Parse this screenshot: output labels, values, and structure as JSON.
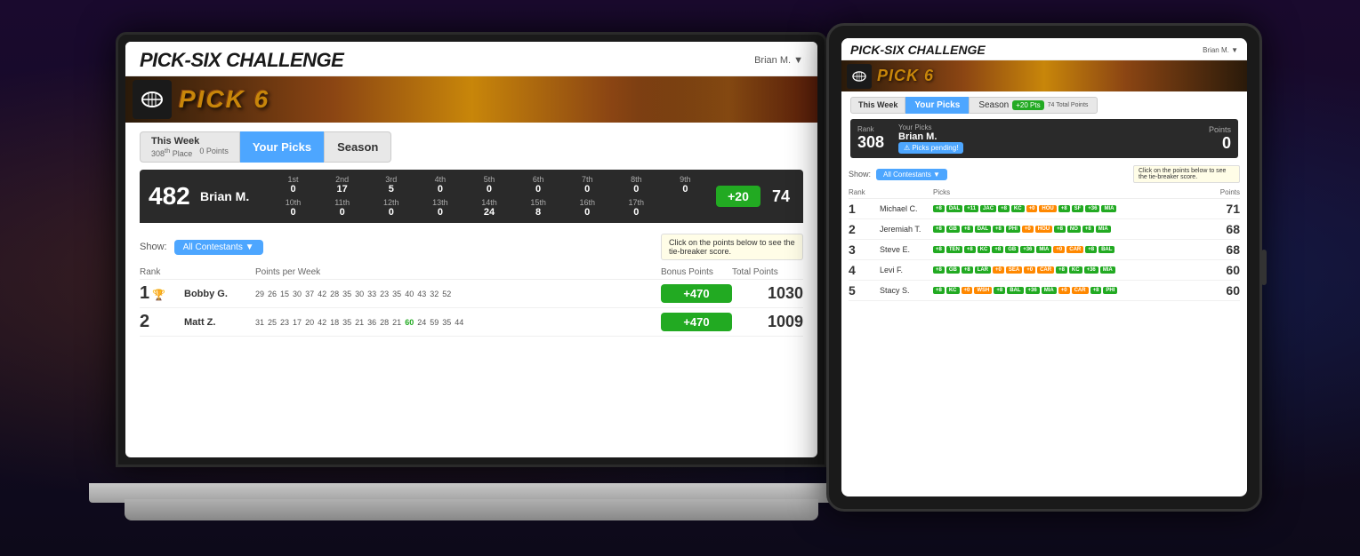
{
  "app": {
    "title": "PICK-SIX CHALLENGE",
    "user": "Brian M. ▼",
    "banner_text": "PICK 6"
  },
  "laptop": {
    "tabs": {
      "this_week": "This Week",
      "your_picks": "Your Picks",
      "season": "Season"
    },
    "current_user": {
      "rank": "482",
      "place": "th",
      "name": "Brian M.",
      "points_week": [
        {
          "label": "1st",
          "val": "0"
        },
        {
          "label": "2nd",
          "val": "17"
        },
        {
          "label": "3rd",
          "val": "5"
        },
        {
          "label": "4th",
          "val": "0"
        },
        {
          "label": "5th",
          "val": "0"
        },
        {
          "label": "6th",
          "val": "0"
        },
        {
          "label": "7th",
          "val": "0"
        },
        {
          "label": "8th",
          "val": "0"
        },
        {
          "label": "9th",
          "val": "0"
        },
        {
          "label": "10th",
          "val": "0"
        },
        {
          "label": "11th",
          "val": "0"
        },
        {
          "label": "12th",
          "val": "0"
        },
        {
          "label": "13th",
          "val": "0"
        },
        {
          "label": "14th",
          "val": "24"
        },
        {
          "label": "15th",
          "val": "8"
        },
        {
          "label": "16th",
          "val": "0"
        },
        {
          "label": "17th",
          "val": "0"
        }
      ],
      "bonus_points": "+20",
      "total_points": "74"
    },
    "show_label": "Show:",
    "show_option": "All Contestants ▼",
    "tooltip": "Click on the points below to see the tie-breaker score.",
    "columns": {
      "rank": "Rank",
      "points_per_week": "Points per Week",
      "bonus_points": "Bonus Points",
      "total_points": "Total Points"
    },
    "leaderboard": [
      {
        "rank": "1",
        "icon": "🏆",
        "name": "Bobby G.",
        "points": "29 26 15 30 37 42 28 35 30 33 23 35 40 43 32 52",
        "bonus": "+470",
        "total": "1030"
      },
      {
        "rank": "2",
        "name": "Matt Z.",
        "points": "31 25 23 17 20 42 18 35 21 36 28 21 60 24 59 35 44",
        "bonus": "+470",
        "total": "1009"
      }
    ]
  },
  "tablet": {
    "user": "Brian M. ▼",
    "title": "PICK-SIX CHALLENGE",
    "banner_text": "PICK 6",
    "tabs": {
      "this_week": "This Week",
      "your_picks": "Your Picks",
      "season": "Season"
    },
    "current_user": {
      "rank": "308",
      "name": "Brian M.",
      "picks_pending": "⚠ Picks pending!",
      "points_label": "Points",
      "points_val": "0",
      "bonus": "+20",
      "bonus_label": "Pts",
      "total": "74",
      "total_label": "Total Points"
    },
    "show_label": "Show:",
    "show_option": "All Contestants ▼",
    "tooltip": "Click on the points below to see the tie-breaker score.",
    "columns": {
      "rank": "Rank",
      "picks": "Picks",
      "points": "Points"
    },
    "leaderboard": [
      {
        "rank": "1",
        "name": "Michael C.",
        "picks": [
          {
            "label": "+8",
            "color": "green"
          },
          {
            "label": "DAL",
            "color": "green"
          },
          {
            "label": "+11",
            "color": "green"
          },
          {
            "label": "JAC",
            "color": "green"
          },
          {
            "label": "+8",
            "color": "green"
          },
          {
            "label": "KC",
            "color": "green"
          },
          {
            "label": "+0",
            "color": "orange"
          },
          {
            "label": "HOU",
            "color": "orange"
          },
          {
            "label": "+8",
            "color": "green"
          },
          {
            "label": "SF",
            "color": "green"
          },
          {
            "label": "+36",
            "color": "green"
          },
          {
            "label": "MIA",
            "color": "green"
          }
        ],
        "points": "71"
      },
      {
        "rank": "2",
        "name": "Jeremiah T.",
        "picks": [
          {
            "label": "+8",
            "color": "green"
          },
          {
            "label": "GB",
            "color": "green"
          },
          {
            "label": "+8",
            "color": "green"
          },
          {
            "label": "DAL",
            "color": "green"
          },
          {
            "label": "+8",
            "color": "green"
          },
          {
            "label": "PHI",
            "color": "green"
          },
          {
            "label": "+0",
            "color": "orange"
          },
          {
            "label": "HOU",
            "color": "orange"
          },
          {
            "label": "+8",
            "color": "green"
          },
          {
            "label": "NO",
            "color": "green"
          },
          {
            "label": "+8",
            "color": "green"
          },
          {
            "label": "MIA",
            "color": "green"
          }
        ],
        "points": "68"
      },
      {
        "rank": "3",
        "name": "Steve E.",
        "picks": [
          {
            "label": "+8",
            "color": "green"
          },
          {
            "label": "TEN",
            "color": "green"
          },
          {
            "label": "+8",
            "color": "green"
          },
          {
            "label": "KC",
            "color": "green"
          },
          {
            "label": "+8",
            "color": "green"
          },
          {
            "label": "GB",
            "color": "green"
          },
          {
            "label": "+36",
            "color": "green"
          },
          {
            "label": "MIA",
            "color": "green"
          },
          {
            "label": "+0",
            "color": "orange"
          },
          {
            "label": "CAR",
            "color": "orange"
          },
          {
            "label": "+8",
            "color": "green"
          },
          {
            "label": "BAL",
            "color": "green"
          }
        ],
        "points": "68"
      },
      {
        "rank": "4",
        "name": "Levi F.",
        "picks": [
          {
            "label": "+8",
            "color": "green"
          },
          {
            "label": "GB",
            "color": "green"
          },
          {
            "label": "+8",
            "color": "green"
          },
          {
            "label": "LAR",
            "color": "green"
          },
          {
            "label": "+0",
            "color": "orange"
          },
          {
            "label": "SEA",
            "color": "orange"
          },
          {
            "label": "+0",
            "color": "orange"
          },
          {
            "label": "CAR",
            "color": "orange"
          },
          {
            "label": "+8",
            "color": "green"
          },
          {
            "label": "KC",
            "color": "green"
          },
          {
            "label": "+36",
            "color": "green"
          },
          {
            "label": "MIA",
            "color": "green"
          }
        ],
        "points": "60"
      },
      {
        "rank": "5",
        "name": "Stacy S.",
        "picks": [
          {
            "label": "+8",
            "color": "green"
          },
          {
            "label": "KC",
            "color": "green"
          },
          {
            "label": "+0",
            "color": "orange"
          },
          {
            "label": "WSH",
            "color": "orange"
          },
          {
            "label": "+8",
            "color": "green"
          },
          {
            "label": "BAL",
            "color": "green"
          },
          {
            "label": "+36",
            "color": "green"
          },
          {
            "label": "MIA",
            "color": "green"
          },
          {
            "label": "+0",
            "color": "orange"
          },
          {
            "label": "CAR",
            "color": "orange"
          },
          {
            "label": "+8",
            "color": "green"
          },
          {
            "label": "PHI",
            "color": "green"
          }
        ],
        "points": "60"
      }
    ]
  }
}
